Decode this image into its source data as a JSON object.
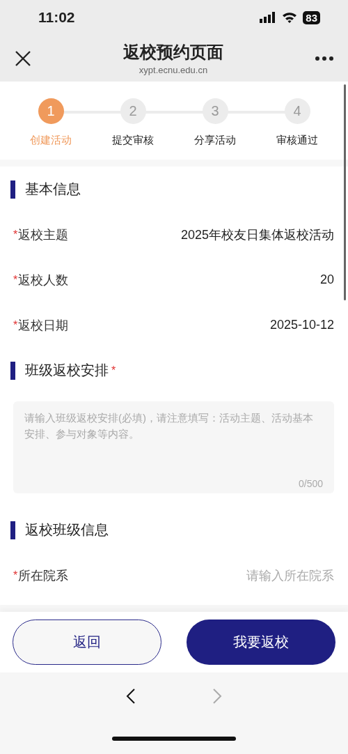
{
  "status_bar": {
    "time": "11:02",
    "battery": "83"
  },
  "header": {
    "title": "返校预约页面",
    "url": "xypt.ecnu.edu.cn"
  },
  "steps": [
    {
      "number": "1",
      "label": "创建活动",
      "selected": true
    },
    {
      "number": "2",
      "label": "提交审核",
      "selected": false
    },
    {
      "number": "3",
      "label": "分享活动",
      "selected": false
    },
    {
      "number": "4",
      "label": "审核通过",
      "selected": false
    }
  ],
  "sections": [
    {
      "title": "基本信息",
      "fields": [
        {
          "label": "返校主题",
          "required_mark": "*",
          "value": "2025年校友日集体返校活动"
        },
        {
          "label": "返校人数",
          "required_mark": "*",
          "value": "20"
        },
        {
          "label": "返校日期",
          "required_mark": "*",
          "value": "2025-10-12"
        }
      ]
    },
    {
      "title": "班级返校安排",
      "required_mark": "*",
      "textarea": {
        "placeholder": "请输入班级返校安排(必填)，请注意填写：活动主题、活动基本安排、参与对象等内容。",
        "counter": "0/500"
      }
    },
    {
      "title": "返校班级信息",
      "fields": [
        {
          "label": "所在院系",
          "required_mark": "*",
          "placeholder": "请输入所在院系"
        }
      ]
    }
  ],
  "buttons": [
    {
      "label": "返回",
      "kind": "outline"
    },
    {
      "label": "我要返校",
      "kind": "primary"
    }
  ],
  "browser_nav": {
    "back_disabled": false,
    "forward_disabled": true
  }
}
